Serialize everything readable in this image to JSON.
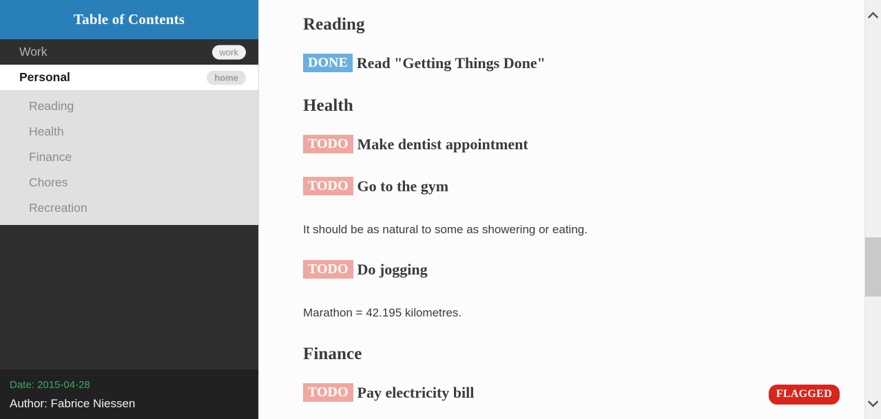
{
  "sidebar": {
    "header_title": "Table of Contents",
    "items": [
      {
        "label": "Work",
        "tag": "work",
        "level": 1,
        "current": false
      },
      {
        "label": "Personal",
        "tag": "home",
        "level": 1,
        "current": true
      },
      {
        "label": "Reading",
        "tag": "",
        "level": 2,
        "current": false
      },
      {
        "label": "Health",
        "tag": "",
        "level": 2,
        "current": false
      },
      {
        "label": "Finance",
        "tag": "",
        "level": 2,
        "current": false
      },
      {
        "label": "Chores",
        "tag": "",
        "level": 2,
        "current": false
      },
      {
        "label": "Recreation",
        "tag": "",
        "level": 2,
        "current": false
      }
    ],
    "footer": {
      "date": "Date: 2015-04-28",
      "author": "Author: Fabrice Niessen"
    }
  },
  "content": {
    "blocks": [
      {
        "kind": "heading",
        "text": "Reading"
      },
      {
        "kind": "todo",
        "keyword": "DONE",
        "text": "Read \"Getting Things Done\"",
        "flag": ""
      },
      {
        "kind": "heading",
        "text": "Health"
      },
      {
        "kind": "todo",
        "keyword": "TODO",
        "text": "Make dentist appointment",
        "flag": ""
      },
      {
        "kind": "todo",
        "keyword": "TODO",
        "text": "Go to the gym",
        "flag": ""
      },
      {
        "kind": "para",
        "text": "It should be as natural to some as showering or eating."
      },
      {
        "kind": "todo",
        "keyword": "TODO",
        "text": "Do jogging",
        "flag": ""
      },
      {
        "kind": "para",
        "text": "Marathon = 42.195 kilometres."
      },
      {
        "kind": "heading",
        "text": "Finance"
      },
      {
        "kind": "todo",
        "keyword": "TODO",
        "text": "Pay electricity bill",
        "flag": "FLAGGED"
      }
    ]
  },
  "scrollbar": {
    "up_arrow_icon": "chevron-up-icon",
    "down_arrow_icon": "chevron-down-icon"
  },
  "colors": {
    "header_blue": "#2980b9",
    "sidebar_dark": "#2f2f2d",
    "sidebar_footer": "#212121",
    "sublist_gray": "#e0e0e0",
    "todo_badge": "#f0a7a0",
    "done_badge": "#6ab0de",
    "flag_red": "#d9261c",
    "date_green": "#3fa563"
  }
}
